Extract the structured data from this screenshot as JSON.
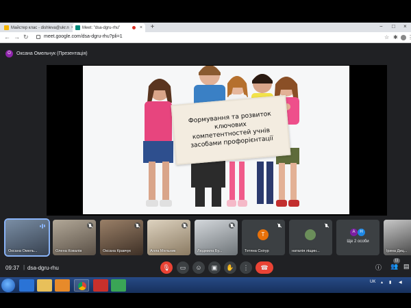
{
  "browser": {
    "tabs": [
      {
        "title": "Майстер клас - dishleva@ukr.n",
        "close": "×"
      },
      {
        "title": "Meet: \"dsa-dgru-rhu\"",
        "close": "×"
      }
    ],
    "new_tab": "+",
    "window_controls": {
      "minimize": "−",
      "maximize": "□",
      "close": "×"
    },
    "nav": {
      "back": "←",
      "forward": "→",
      "reload": "↻"
    },
    "url": "meet.google.com/dsa-dgru-rhu?pli=1",
    "toolbar_icons": [
      "star-icon",
      "extensions-icon",
      "profile-icon",
      "menu-icon"
    ]
  },
  "meet": {
    "presenter": {
      "initial": "O",
      "label": "Оксана Омельчук (Презентація)"
    },
    "slide": {
      "sign_text": "Формування  та розвиток\nключових\nкомпетентностей учнів\nзасобами профорієнтації"
    },
    "tiles": [
      {
        "name": "Оксана Омель...",
        "type": "video",
        "active": true,
        "speaking": true,
        "color": "#4a5a6e"
      },
      {
        "name": "Олена Ковалів",
        "type": "video",
        "mic_off": true,
        "color": "#8d8070"
      },
      {
        "name": "Оксана Кравчук",
        "type": "video",
        "mic_off": true,
        "color": "#6e5a48"
      },
      {
        "name": "Алла Мельник",
        "type": "video",
        "mic_off": true,
        "color": "#b7a38a"
      },
      {
        "name": "Людмила Бу...",
        "type": "video",
        "mic_off": true,
        "color": "#9aa2a8"
      },
      {
        "name": "Тетяна Снігур",
        "type": "letter",
        "initial": "Т",
        "avatar_color": "#e8710a",
        "mic_off": true
      },
      {
        "name": "наталія ліщин...",
        "type": "photo",
        "mic_off": true
      },
      {
        "name": "Ще 2 особи",
        "type": "more",
        "initials": [
          "A",
          "Н"
        ]
      },
      {
        "name": "Ірина Диц...",
        "type": "video",
        "color": "#6a6a6a"
      }
    ],
    "time": "09:37",
    "separator": "|",
    "meeting_code": "dsa-dgru-rhu",
    "participants_count": "11",
    "controls": [
      "mic-off-icon",
      "camera-icon",
      "captions-icon",
      "present-icon",
      "raise-hand-icon",
      "more-options-icon",
      "hang-up-icon"
    ],
    "right_controls": [
      "info-icon",
      "people-icon",
      "chat-icon"
    ]
  },
  "taskbar": {
    "apps": [
      "ie-icon",
      "explorer-icon",
      "media-icon",
      "chrome-icon",
      "acrobat-icon",
      "app-icon"
    ],
    "tray": {
      "lang": "UK"
    }
  }
}
